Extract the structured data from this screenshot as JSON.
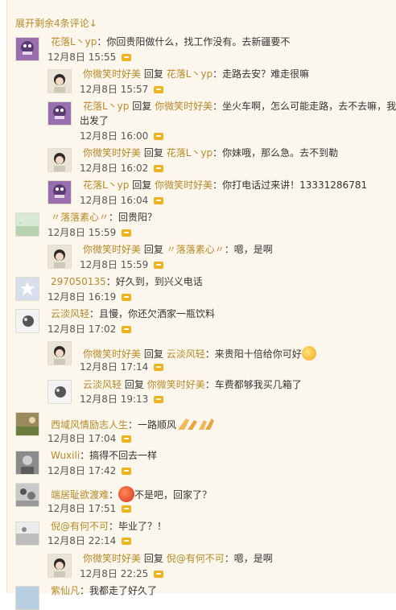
{
  "expand_label": "展开剩余4条评论↓",
  "reply_icon": "reply-icon",
  "comments": [
    {
      "id": "c1",
      "user": "花落L丶yp",
      "text": "你回贵阳做什么，找工作没有。去新疆要不",
      "date": "12月8日",
      "time": "15:55"
    },
    {
      "id": "c2",
      "user": "你微笑时好美",
      "reply_word": "回复",
      "target": "花落L丶yp",
      "text": "走路去安？难走很嘛",
      "date": "12月8日",
      "time": "15:57"
    },
    {
      "id": "c3",
      "user": "花落L丶yp",
      "reply_word": "回复",
      "target": "你微笑时好美",
      "text": "坐火车啊，怎么可能走路，去不去嘛，我",
      "text_line2": "出发了",
      "date": "12月8日",
      "time": "16:00"
    },
    {
      "id": "c4",
      "user": "你微笑时好美",
      "reply_word": "回复",
      "target": "花落L丶yp",
      "text": "你妹哦，那么急。去不到勒",
      "date": "12月8日",
      "time": "16:02"
    },
    {
      "id": "c5",
      "user": "花落L丶yp",
      "reply_word": "回复",
      "target": "你微笑时好美",
      "text": "你打电话过来讲！13331286781",
      "date": "12月8日",
      "time": "16:04"
    },
    {
      "id": "c6",
      "user": "〃落落素心〃",
      "text": "回贵阳？",
      "date": "12月8日",
      "time": "15:59"
    },
    {
      "id": "c7",
      "user": "你微笑时好美",
      "reply_word": "回复",
      "target": "〃落落素心〃",
      "text": "嗯，是啊",
      "date": "12月8日",
      "time": "15:59"
    },
    {
      "id": "c8",
      "user": "297050135",
      "text": "好久到，到兴义电话",
      "date": "12月8日",
      "time": "16:19"
    },
    {
      "id": "c9",
      "user": "云淡风轻",
      "text": "且慢，你还欠洒家一瓶饮料",
      "date": "12月8日",
      "time": "17:02"
    },
    {
      "id": "c10",
      "user": "你微笑时好美",
      "reply_word": "回复",
      "target": "云淡风轻",
      "text": "来贵阳十倍给你可好",
      "emoji": "grin-emoji",
      "date": "12月8日",
      "time": "17:14"
    },
    {
      "id": "c11",
      "user": "云淡风轻",
      "reply_word": "回复",
      "target": "你微笑时好美",
      "text": "车费都够我买几箱了",
      "date": "12月8日",
      "time": "19:13"
    },
    {
      "id": "c12",
      "user": "西域风情励志人生",
      "text": "一路顺风",
      "emoji": "clapping-hands-emoji",
      "date": "12月8日",
      "time": "17:04"
    },
    {
      "id": "c13",
      "user": "Wuxili",
      "text": "搞得不回去一样",
      "date": "12月8日",
      "time": "17:42"
    },
    {
      "id": "c14",
      "user": "端居耻欲渡难",
      "text": "不是吧，回家了？",
      "emoji": "angry-emoji",
      "date": "12月8日",
      "time": "17:51"
    },
    {
      "id": "c15",
      "user": "倪@有何不可",
      "text": "毕业了？！",
      "date": "12月8日",
      "time": "22:14"
    },
    {
      "id": "c16",
      "user": "你微笑时好美",
      "reply_word": "回复",
      "target": "倪@有何不可",
      "text": "嗯，是啊",
      "date": "12月8日",
      "time": "22:25"
    },
    {
      "id": "c17",
      "user": "紫仙凡",
      "text": "我都走了好久了",
      "date": "",
      "time": ""
    }
  ],
  "colors": {
    "panel_bg": "#fbf7ec",
    "username": "#b8892b",
    "reply_button": "#f0b21d"
  }
}
